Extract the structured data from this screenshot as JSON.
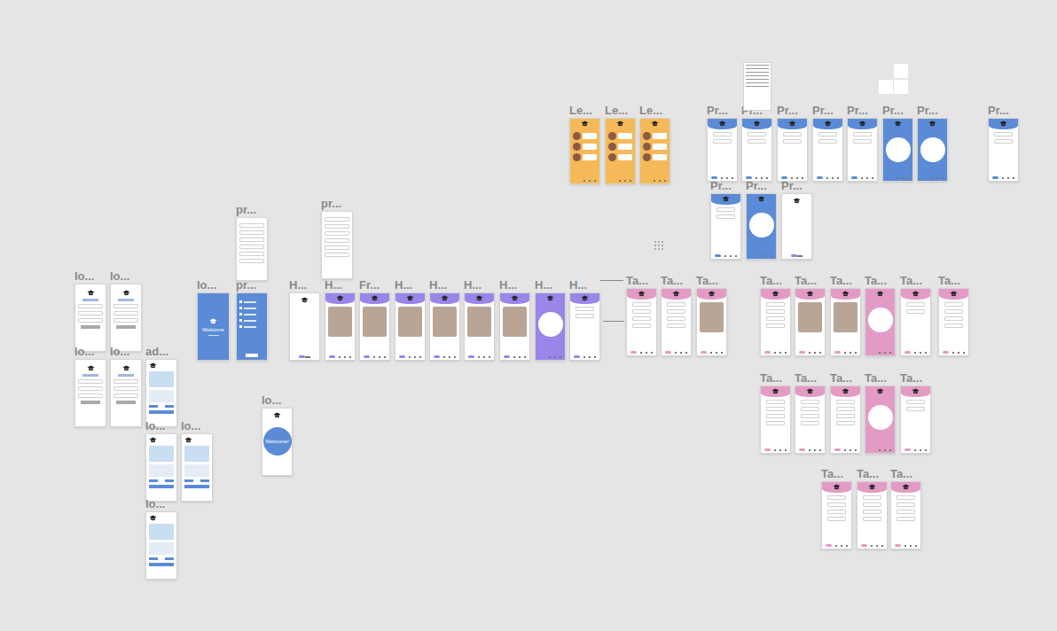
{
  "canvas": {
    "frames": [
      {
        "label": "lo...",
        "kind": "login",
        "title": ""
      },
      {
        "label": "lo...",
        "kind": "login",
        "title": ""
      },
      {
        "label": "lo...",
        "kind": "login",
        "title": ""
      },
      {
        "label": "lo...",
        "kind": "login",
        "title": ""
      },
      {
        "label": "ad...",
        "kind": "idcard",
        "title": ""
      },
      {
        "label": "lo...",
        "kind": "idcard",
        "title": ""
      },
      {
        "label": "lo...",
        "kind": "idcard",
        "title": ""
      },
      {
        "label": "lo...",
        "kind": "idcard",
        "title": ""
      },
      {
        "label": "lo...",
        "kind": "blue",
        "title": "Welcome"
      },
      {
        "label": "pr...",
        "kind": "bluelist",
        "title": ""
      },
      {
        "label": "pr...",
        "kind": "list",
        "title": ""
      },
      {
        "label": "pr...",
        "kind": "list",
        "title": ""
      },
      {
        "label": "lo...",
        "kind": "welcomecircle",
        "title": "Welcome!"
      },
      {
        "label": "H...",
        "kind": "white",
        "title": ""
      },
      {
        "label": "H...",
        "kind": "purplephoto",
        "title": ""
      },
      {
        "label": "Fr...",
        "kind": "purplephoto",
        "title": ""
      },
      {
        "label": "H...",
        "kind": "purplephoto",
        "title": ""
      },
      {
        "label": "H...",
        "kind": "purplephoto",
        "title": ""
      },
      {
        "label": "H...",
        "kind": "purplephoto",
        "title": ""
      },
      {
        "label": "H...",
        "kind": "purplephoto",
        "title": ""
      },
      {
        "label": "H...",
        "kind": "purplefull",
        "title": ""
      },
      {
        "label": "H...",
        "kind": "purpletop",
        "title": ""
      },
      {
        "label": "Ta...",
        "kind": "pinklist",
        "title": ""
      },
      {
        "label": "Ta...",
        "kind": "pinklist",
        "title": ""
      },
      {
        "label": "Ta...",
        "kind": "pinkphoto",
        "title": ""
      },
      {
        "label": "Ta...",
        "kind": "pinklist",
        "title": ""
      },
      {
        "label": "Ta...",
        "kind": "pinkphoto",
        "title": ""
      },
      {
        "label": "Ta...",
        "kind": "pinkphoto",
        "title": ""
      },
      {
        "label": "Ta...",
        "kind": "pinkfull",
        "title": ""
      },
      {
        "label": "Ta...",
        "kind": "pinktop",
        "title": ""
      },
      {
        "label": "Ta...",
        "kind": "pinklist",
        "title": ""
      },
      {
        "label": "Ta...",
        "kind": "pinklist",
        "title": ""
      },
      {
        "label": "Ta...",
        "kind": "pinklist",
        "title": ""
      },
      {
        "label": "Ta...",
        "kind": "pinklist",
        "title": ""
      },
      {
        "label": "Ta...",
        "kind": "pinkfull",
        "title": ""
      },
      {
        "label": "Ta...",
        "kind": "pinktop",
        "title": ""
      },
      {
        "label": "Ta...",
        "kind": "pinklist",
        "title": ""
      },
      {
        "label": "Ta...",
        "kind": "pinklist",
        "title": ""
      },
      {
        "label": "Ta...",
        "kind": "pinklist",
        "title": ""
      },
      {
        "label": "Le...",
        "kind": "orange",
        "title": ""
      },
      {
        "label": "Le...",
        "kind": "orange",
        "title": ""
      },
      {
        "label": "Le...",
        "kind": "orange",
        "title": ""
      },
      {
        "label": "Pr...",
        "kind": "bluetop",
        "title": ""
      },
      {
        "label": "Pr...",
        "kind": "bluetop",
        "title": ""
      },
      {
        "label": "Pr...",
        "kind": "bluetop",
        "title": ""
      },
      {
        "label": "Pr...",
        "kind": "bluetop",
        "title": ""
      },
      {
        "label": "Pr...",
        "kind": "bluetop",
        "title": ""
      },
      {
        "label": "Pr...",
        "kind": "bluecircle",
        "title": ""
      },
      {
        "label": "Pr...",
        "kind": "bluecircle",
        "title": ""
      },
      {
        "label": "Pr...",
        "kind": "bluetop",
        "title": ""
      },
      {
        "label": "Pr...",
        "kind": "bluetop",
        "title": ""
      },
      {
        "label": "Pr...",
        "kind": "bluecircle",
        "title": ""
      },
      {
        "label": "Pr...",
        "kind": "white",
        "title": ""
      }
    ]
  }
}
